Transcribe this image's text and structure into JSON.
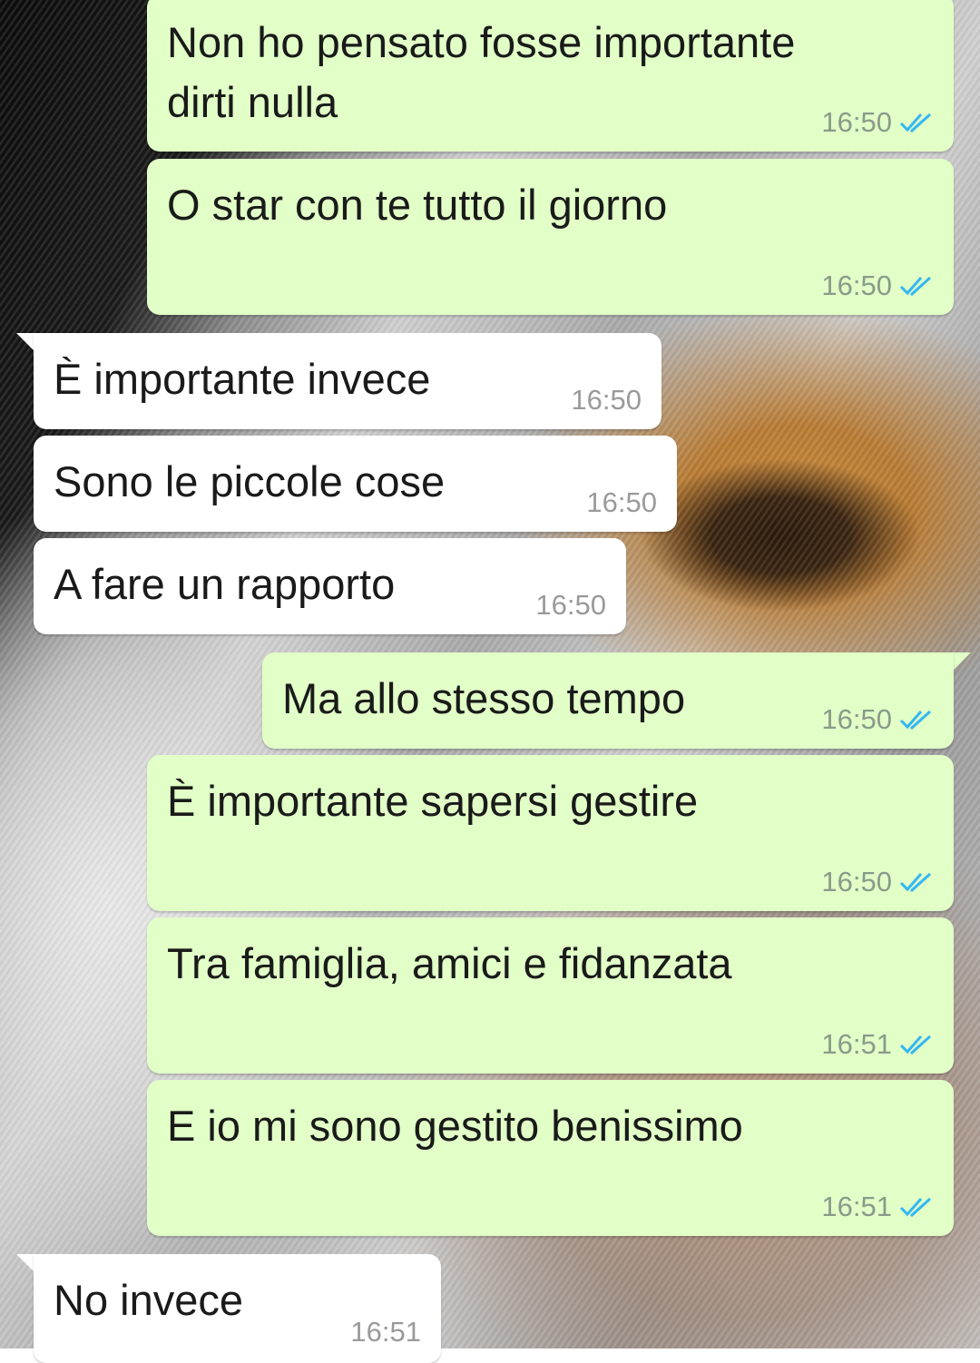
{
  "colors": {
    "outgoing_bubble": "#e1ffc7",
    "incoming_bubble": "#ffffff",
    "read_ticks": "#34b7f1"
  },
  "messages": [
    {
      "direction": "out",
      "text": "Non ho pensato fosse importante\ndirti nulla",
      "time": "16:50",
      "status": "read"
    },
    {
      "direction": "out",
      "text": "O star con te tutto il giorno",
      "time": "16:50",
      "status": "read"
    },
    {
      "direction": "in",
      "text": "È importante invece",
      "time": "16:50"
    },
    {
      "direction": "in",
      "text": "Sono le piccole cose",
      "time": "16:50"
    },
    {
      "direction": "in",
      "text": "A fare un rapporto",
      "time": "16:50"
    },
    {
      "direction": "out",
      "text": "Ma allo stesso tempo",
      "time": "16:50",
      "status": "read"
    },
    {
      "direction": "out",
      "text": "È importante sapersi gestire",
      "time": "16:50",
      "status": "read"
    },
    {
      "direction": "out",
      "text": "Tra famiglia, amici e fidanzata",
      "time": "16:51",
      "status": "read"
    },
    {
      "direction": "out",
      "text": "E io mi sono gestito benissimo",
      "time": "16:51",
      "status": "read"
    },
    {
      "direction": "in",
      "text": "No invece",
      "time": "16:51"
    }
  ],
  "icons": {
    "read": "double-check-icon"
  }
}
